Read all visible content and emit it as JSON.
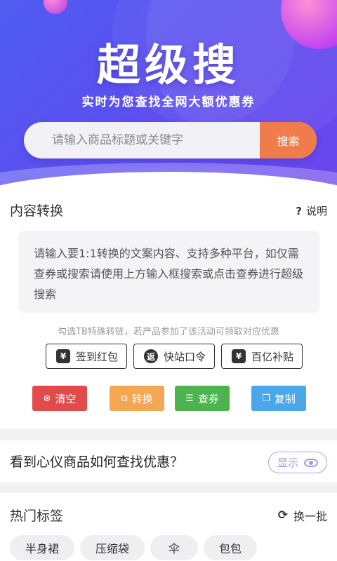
{
  "hero": {
    "title": "超级搜",
    "subtitle": "实时为您查找全网大额优惠券",
    "search_placeholder": "请输入商品标题或关键字",
    "search_button": "搜索"
  },
  "convert": {
    "title": "内容转换",
    "help_icon": "?",
    "help_label": "说明",
    "textarea_placeholder": "请输入要1:1转换的文案内容、支持多种平台，如仅需查券或搜索请使用上方输入框搜索或点击查券进行超级搜索",
    "hint": "勾选TB特殊转链，若产品参加了该活动可领取对应优惠",
    "special_links": [
      {
        "label": "签到红包",
        "icon": "red-envelope-icon",
        "glyph": "¥"
      },
      {
        "label": "快站口令",
        "icon": "return-icon",
        "glyph": "返"
      },
      {
        "label": "百亿补贴",
        "icon": "subsidy-icon",
        "glyph": "¥"
      }
    ],
    "actions": {
      "clear": {
        "label": "清空",
        "icon": "close-circle-icon",
        "color": "#e24a4c"
      },
      "convert": {
        "label": "转换",
        "icon": "convert-icon",
        "color": "#f4a752"
      },
      "query": {
        "label": "查券",
        "icon": "search-doc-icon",
        "color": "#4cb34e"
      },
      "copy": {
        "label": "复制",
        "icon": "copy-icon",
        "color": "#4aa7ea"
      }
    }
  },
  "guide": {
    "question": "看到心仪商品如何查找优惠？",
    "show_button": "显示"
  },
  "hot_tags": {
    "title": "热门标签",
    "refresh_label": "换一批",
    "tags": [
      "半身裙",
      "压缩袋",
      "伞",
      "包包"
    ]
  },
  "colors": {
    "hero_start": "#4f5cf0",
    "hero_end": "#6a45ee",
    "search_button": "#f07b4b",
    "accent_outline": "#a4a6e8"
  }
}
